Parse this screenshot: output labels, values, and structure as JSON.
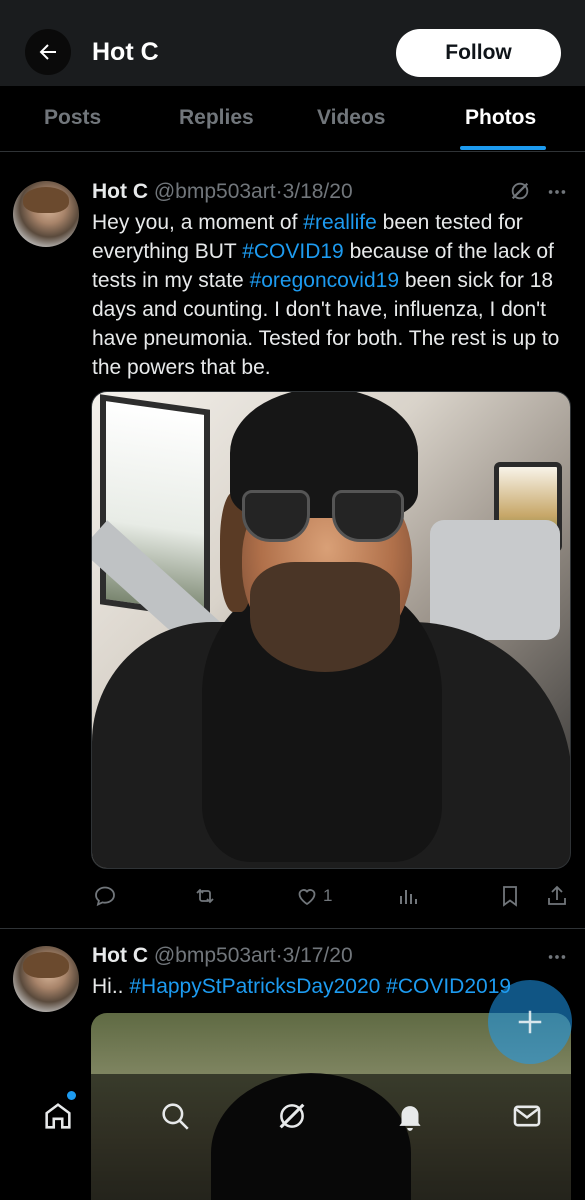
{
  "header": {
    "title": "Hot C",
    "follow_label": "Follow"
  },
  "tabs": [
    {
      "label": "Posts",
      "active": false
    },
    {
      "label": "Replies",
      "active": false
    },
    {
      "label": "Videos",
      "active": false
    },
    {
      "label": "Photos",
      "active": true
    }
  ],
  "posts": [
    {
      "name": "Hot C",
      "handle": "@bmp503art",
      "date": "3/18/20",
      "text_parts": [
        {
          "text": "Hey you, a moment of ",
          "hashtag": false
        },
        {
          "text": "#reallife",
          "hashtag": true
        },
        {
          "text": " been tested for everything BUT ",
          "hashtag": false
        },
        {
          "text": "#COVID19",
          "hashtag": true
        },
        {
          "text": "  because of the lack of tests in my state ",
          "hashtag": false
        },
        {
          "text": "#oregoncovid19",
          "hashtag": true
        },
        {
          "text": " been sick for 18 days and counting. I don't have, influenza, I don't have pneumonia. Tested for both. The rest is up to the powers that be.",
          "hashtag": false
        }
      ],
      "likes": "1"
    },
    {
      "name": "Hot C",
      "handle": "@bmp503art",
      "date": "3/17/20",
      "text_parts": [
        {
          "text": "Hi.. ",
          "hashtag": false
        },
        {
          "text": "#HappyStPatricksDay2020",
          "hashtag": true
        },
        {
          "text": " ",
          "hashtag": false
        },
        {
          "text": "#COVID2019",
          "hashtag": true
        }
      ]
    }
  ],
  "colors": {
    "accent": "#1d9bf0",
    "secondary_text": "#71767b",
    "background": "#000000"
  },
  "icons": {
    "back": "back-arrow-icon",
    "grok": "grok-icon",
    "more": "more-icon",
    "reply": "reply-icon",
    "repost": "repost-icon",
    "like": "heart-icon",
    "views": "views-icon",
    "bookmark": "bookmark-icon",
    "share": "share-icon",
    "compose": "plus-icon",
    "home": "home-icon",
    "search": "search-icon",
    "grok_nav": "grok-nav-icon",
    "notifications": "bell-icon",
    "messages": "mail-icon"
  }
}
